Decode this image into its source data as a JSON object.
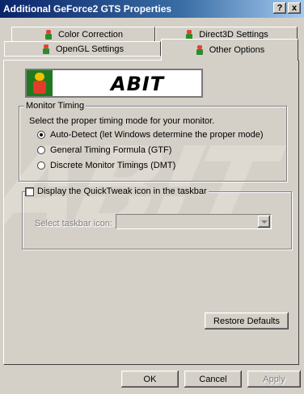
{
  "window": {
    "title": "Additional GeForce2 GTS Properties",
    "help_button": "?",
    "close_button": "x"
  },
  "tabs": {
    "row1": [
      "Color Correction",
      "Direct3D Settings"
    ],
    "row2": [
      "OpenGL Settings",
      "Other Options"
    ],
    "active": "Other Options"
  },
  "banner": {
    "logo_text": "ABIT"
  },
  "monitor_timing": {
    "group_label": "Monitor Timing",
    "instruction": "Select the proper timing mode for your monitor.",
    "options": [
      {
        "label": "Auto-Detect (let Windows determine the proper mode)",
        "checked": true
      },
      {
        "label": "General Timing Formula (GTF)",
        "checked": false
      },
      {
        "label": "Discrete Monitor Timings (DMT)",
        "checked": false
      }
    ]
  },
  "quicktweak": {
    "checkbox_label": "Display the QuickTweak icon in the taskbar",
    "checked": false,
    "select_label": "Select taskbar icon:",
    "select_value": ""
  },
  "buttons": {
    "restore_defaults": "Restore Defaults",
    "ok": "OK",
    "cancel": "Cancel",
    "apply": "Apply"
  },
  "watermark": "ABIT"
}
